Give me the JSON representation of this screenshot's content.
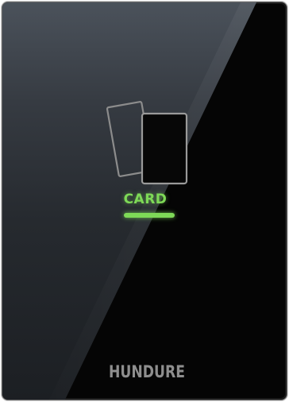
{
  "device": {
    "type": "card reader panel",
    "indicator_label": "CARD",
    "indicator_color": "#7ed957",
    "brand": "HUNDURE",
    "icon": "two-cards-icon"
  }
}
